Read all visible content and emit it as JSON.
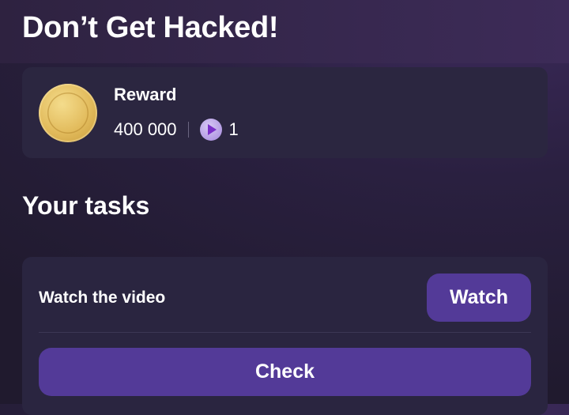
{
  "header": {
    "title": "Don’t Get Hacked!"
  },
  "reward": {
    "label": "Reward",
    "coins": "400 000",
    "video_count": "1",
    "icons": [
      "coin-icon",
      "video-play-icon"
    ]
  },
  "tasks": {
    "heading": "Your tasks",
    "items": [
      {
        "label": "Watch the video",
        "action_label": "Watch"
      }
    ],
    "check_label": "Check"
  },
  "colors": {
    "background": "#241d33",
    "card": "#2b2640",
    "button": "#533a98",
    "coin": "#e2bb5c",
    "video_icon": "#a488dc"
  }
}
